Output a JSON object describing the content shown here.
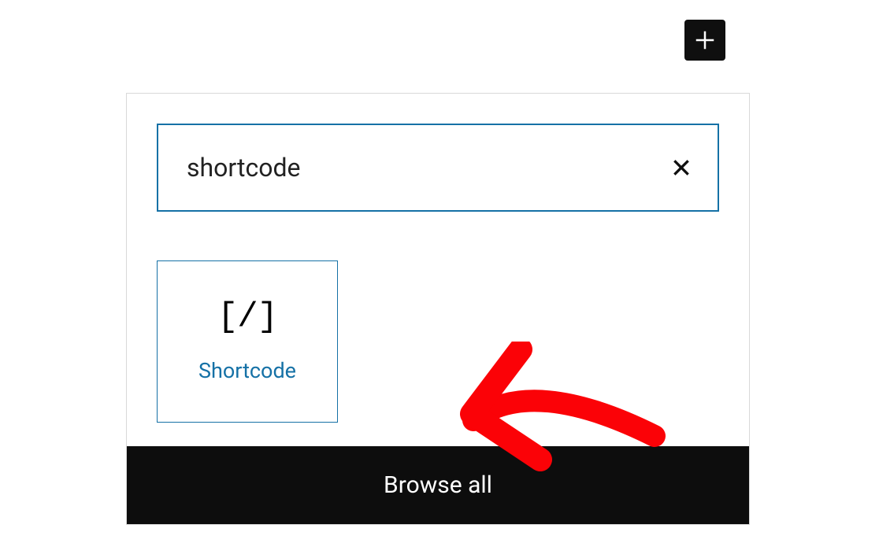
{
  "search": {
    "value": "shortcode",
    "placeholder": ""
  },
  "results": [
    {
      "icon_text": "[/]",
      "label": "Shortcode"
    }
  ],
  "footer": {
    "browse_all": "Browse all"
  },
  "colors": {
    "accent": "#1571a6",
    "dark": "#0d0d0d",
    "annotation": "#fb0207"
  }
}
